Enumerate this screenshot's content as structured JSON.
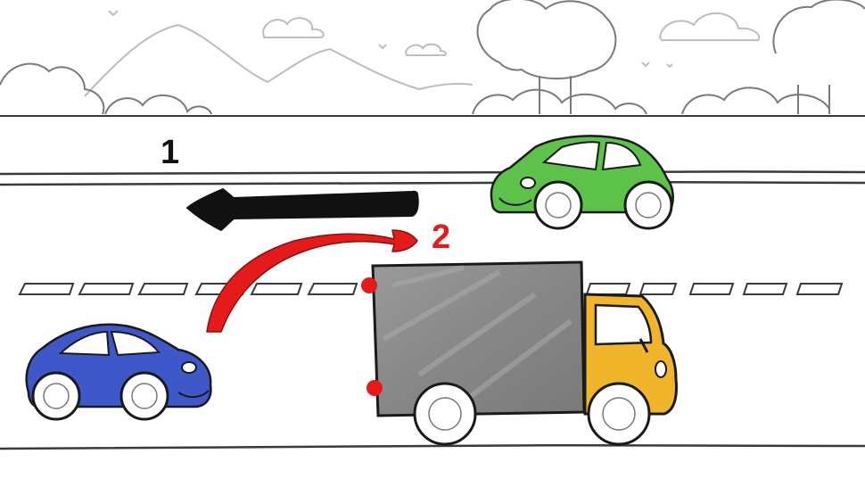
{
  "labels": {
    "step_1": "1",
    "step_2": "2"
  },
  "colors": {
    "green_car": "#5cc24a",
    "blue_car": "#3f58c9",
    "truck_cab": "#f0b52a",
    "truck_box": "#8f8f8f",
    "arrow_1": "#111111",
    "arrow_2": "#e51b1b",
    "marker": "#e51b1b"
  },
  "vehicles": [
    {
      "name": "green-car",
      "lane": "upper"
    },
    {
      "name": "truck",
      "lane": "lower"
    },
    {
      "name": "blue-car",
      "lane": "lower"
    }
  ]
}
